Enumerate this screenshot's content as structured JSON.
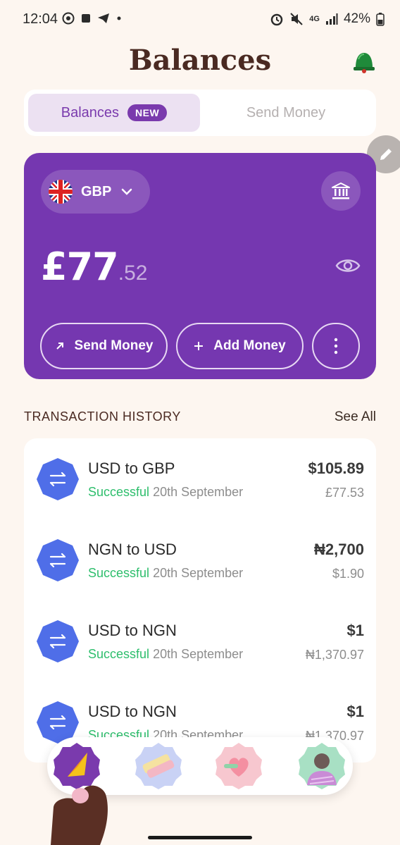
{
  "status_bar": {
    "time": "12:04",
    "battery": "42%",
    "network": "4G"
  },
  "header": {
    "title": "Balances"
  },
  "tabs": [
    {
      "label": "Balances",
      "badge": "NEW",
      "active": true
    },
    {
      "label": "Send Money",
      "active": false
    }
  ],
  "wallet": {
    "currency": "GBP",
    "balance_main": "£77",
    "balance_decimal": ".52",
    "actions": {
      "send": "Send Money",
      "add": "Add Money"
    },
    "card_color": "#7537b0"
  },
  "transactions": {
    "title": "TRANSACTION HISTORY",
    "see_all": "See All",
    "items": [
      {
        "title": "USD to GBP",
        "status": "Successful",
        "date": "20th September",
        "amount": "$105.89",
        "converted": "£77.53"
      },
      {
        "title": "NGN to USD",
        "status": "Successful",
        "date": "20th September",
        "amount": "₦2,700",
        "converted": "$1.90"
      },
      {
        "title": "USD to NGN",
        "status": "Successful",
        "date": "20th September",
        "amount": "$1",
        "converted": "₦1,370.97"
      },
      {
        "title": "USD to NGN",
        "status": "Successful",
        "date": "20th September",
        "amount": "$1",
        "converted": "₦1,370.97"
      }
    ]
  },
  "colors": {
    "accent": "#7a3aad",
    "success": "#2dbe6c",
    "tx_icon": "#4f6ee8",
    "background": "#fdf6f0"
  },
  "icons": [
    "whatsapp-icon",
    "telegram-icon",
    "alarm-icon",
    "mute-icon",
    "signal-icon",
    "battery-icon",
    "bell-icon",
    "edit-icon",
    "uk-flag-icon",
    "chevron-down-icon",
    "bank-icon",
    "eye-icon",
    "arrow-up-right-icon",
    "plus-icon",
    "more-vertical-icon",
    "swap-icon",
    "home-nav-icon",
    "cards-nav-icon",
    "gift-nav-icon",
    "profile-nav-icon"
  ]
}
